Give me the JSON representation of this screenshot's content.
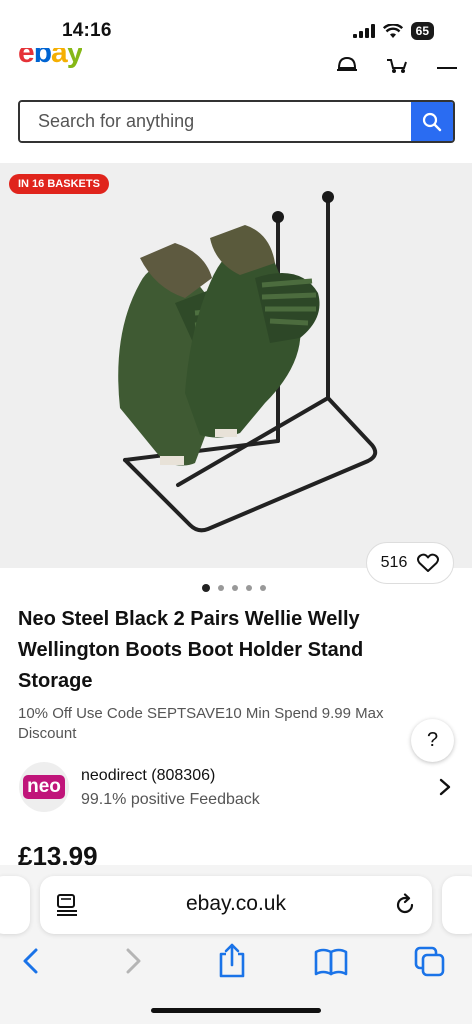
{
  "status": {
    "time": "14:16",
    "battery": "65"
  },
  "header": {
    "logo": "ebay"
  },
  "search": {
    "placeholder": "Search for anything"
  },
  "gallery": {
    "badge": "IN 16 BASKETS",
    "likes": "516",
    "image_count": 5,
    "active_index": 0
  },
  "listing": {
    "title": "Neo Steel Black 2 Pairs Wellie Welly Wellington Boots Boot Holder Stand Storage",
    "promo": "10% Off Use Code SEPTSAVE10 Min Spend 9.99 Max Discount",
    "help": "?",
    "price": "£13.99"
  },
  "seller": {
    "avatar_text": "neo",
    "name": "neodirect (808306)",
    "feedback": "99.1% positive Feedback"
  },
  "browser": {
    "url": "ebay.co.uk"
  },
  "colors": {
    "accent_blue": "#2a6cf2",
    "badge_red": "#e0241c",
    "seller_magenta": "#c0157a",
    "ios_blue": "#1a73e8"
  }
}
